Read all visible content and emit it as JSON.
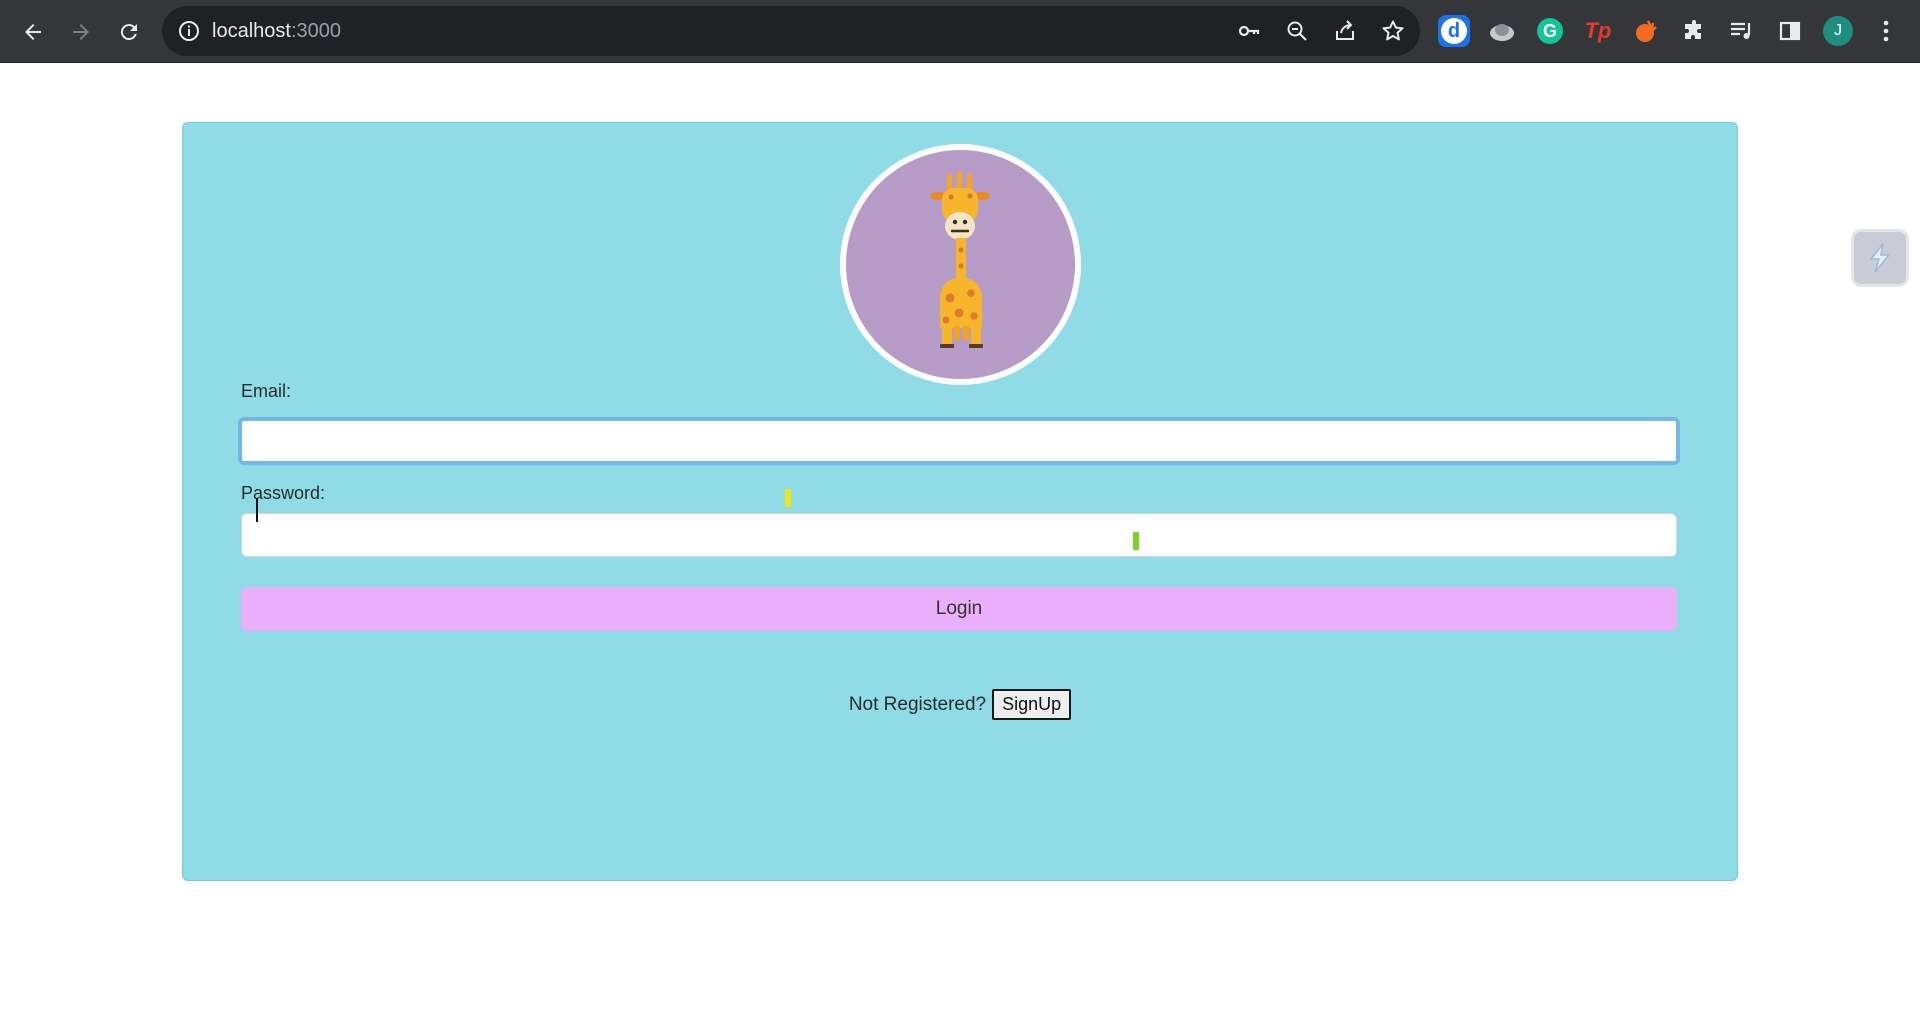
{
  "browser": {
    "url_host": "localhost",
    "url_port": ":3000",
    "profile_initial": "J",
    "extensions": [
      "dictionary-ext-icon",
      "cloud-ext-icon",
      "grammarly-icon",
      "tp-ext-icon",
      "hand-ext-icon",
      "puzzle-icon",
      "media-icon",
      "sidepanel-icon"
    ]
  },
  "form": {
    "email_label": "Email:",
    "email_value": "",
    "password_label": "Password:",
    "password_value": "",
    "login_label": "Login",
    "not_registered_text": "Not Registered?",
    "signup_label": "SignUp"
  },
  "colors": {
    "card_bg": "#8fdbe6",
    "logo_bg": "#b79cc8",
    "login_bg": "#ebb0fb"
  }
}
